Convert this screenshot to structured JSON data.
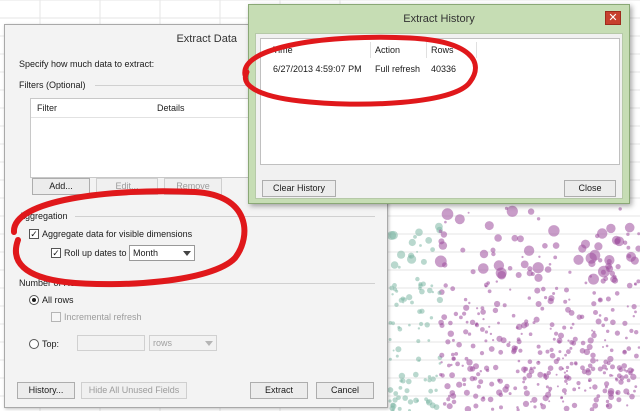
{
  "extract_dialog": {
    "title": "Extract Data",
    "instruction": "Specify how much data to extract:",
    "filters_label": "Filters (Optional)",
    "filter_columns": [
      "Filter",
      "Details"
    ],
    "add_label": "Add...",
    "edit_label": "Edit...",
    "remove_label": "Remove",
    "aggregation_label": "Aggregation",
    "aggregate_visible_label": "Aggregate data for visible dimensions",
    "aggregate_visible_checked": true,
    "rollup_label": "Roll up dates to",
    "rollup_checked": true,
    "rollup_value": "Month",
    "number_of_rows_label": "Number of Rows",
    "all_rows_label": "All rows",
    "incremental_label": "Incremental refresh",
    "top_label": "Top:",
    "top_unit": "rows",
    "history_label": "History...",
    "hide_unused_label": "Hide All Unused Fields",
    "extract_label": "Extract",
    "cancel_label": "Cancel"
  },
  "history_dialog": {
    "title": "Extract History",
    "close_glyph": "✕",
    "columns": [
      "Time",
      "Action",
      "Rows"
    ],
    "rows": [
      {
        "time": "6/27/2013 4:59:07 PM",
        "action": "Full refresh",
        "rows": "40336"
      }
    ],
    "clear_label": "Clear History",
    "close_label": "Close"
  },
  "colors": {
    "annotation_red": "#e0181b",
    "scatter_purple": "#9c4d9c",
    "scatter_teal": "#7fb8a6",
    "history_frame": "#c6ddb4"
  }
}
